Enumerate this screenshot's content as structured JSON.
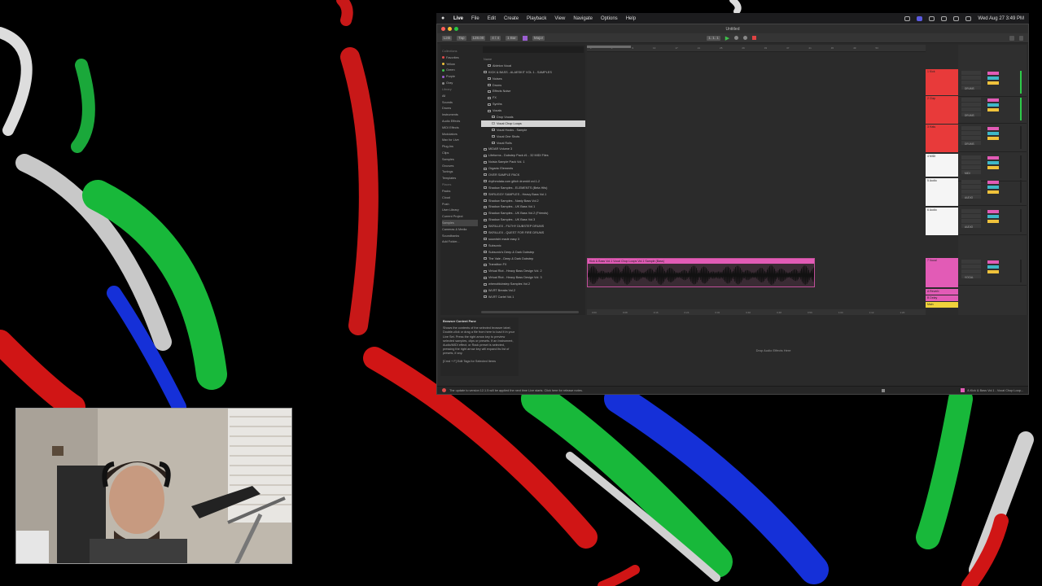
{
  "menubar": {
    "app": "Live",
    "items": [
      "File",
      "Edit",
      "Create",
      "Playback",
      "View",
      "Navigate",
      "Options",
      "Help"
    ],
    "clock": "Wed Aug 27 3:49 PM"
  },
  "window": {
    "title": "Untitled"
  },
  "transport": {
    "link": "Link",
    "tap": "Tap",
    "tempo": "128.00",
    "signature": "4 / 4",
    "quant": "1 Bar",
    "key": "Major",
    "position": "1. 1. 1"
  },
  "browser": {
    "collections_header": "Collections",
    "collections": [
      {
        "label": "Favorites",
        "color": "#e14b4b"
      },
      {
        "label": "Yellow",
        "color": "#f0c23b"
      },
      {
        "label": "Green",
        "color": "#3ec14b"
      },
      {
        "label": "Purple",
        "color": "#9a5fd0"
      },
      {
        "label": "Gray",
        "color": "#8a8a8a"
      }
    ],
    "library_header": "Library",
    "library": [
      "All",
      "Sounds",
      "Drums",
      "Instruments",
      "Audio Effects",
      "MIDI Effects",
      "Modulators",
      "Max for Live",
      "Plug-Ins",
      "Clips",
      "Samples",
      "Grooves",
      "Tunings",
      "Templates"
    ],
    "places_header": "Places",
    "places": [
      "Packs",
      "Cloud",
      "Push",
      "User Library",
      "Current Project",
      "Samples",
      "Cameras & Media",
      "Soundbanks",
      "Add Folder..."
    ],
    "search_placeholder": "Search",
    "name_header": "Name",
    "files": [
      "Ableton Vocal",
      "KICK & BASS - ALAESKIT VOL 1 - SAMPLES",
      "Noises",
      "Drums",
      "Effects Noise",
      "FX",
      "Synths",
      "Vocals",
      "Drop Vocals",
      "Vocal Chop Loops",
      "Vocal Hooks - Sample",
      "Vocal One Shots",
      "Vocal Rolls",
      "MIDAR Volume 3",
      "Lifeforms - Dubstep Pack #1 - 32 MIDI Files",
      "Noisia Sample Pack Vol. 1",
      "Organic Elements",
      "OVER SAMPLE PACK",
      "rhythmdata.com glitch drumkit vol.1-2",
      "Shadow Samples - ELEMENTS (Beta Hits)",
      "SHRUGGY SAMPLES - Heavy Bass Vol.1",
      "Shadow Samples - Nasty Bass Vol.2",
      "Shadow Samples - UK Bass Vol.1",
      "Shadow Samples - UK Bass Vol.2 (Friends)",
      "Shadow Samples - UK Bass Vol.3",
      "SKRILLEX - FILTHY DUBSTEP DRUMS",
      "SKRILLEX - QUEST FOR FIRE DRUMS",
      "soundshi made easy 3",
      "Subsonic",
      "Subsonic's Deep & Dark Dubstep",
      "The Vale - Deep & Dark Dubstep",
      "Transition FX",
      "Virtual Riot - Heavy Bass Design Vol. 2",
      "Virtual Riot - Heavy Bass Design Vol. 3",
      "whenofdubstep Samples Vol.2",
      "WLRT Breaks Vol.2",
      "WLRT Cartel Vol.1"
    ],
    "selected_index": 9
  },
  "arrangement": {
    "ruler": [
      "1",
      "5",
      "9",
      "13",
      "17",
      "21",
      "25",
      "29",
      "33",
      "37",
      "41",
      "45",
      "49",
      "53"
    ],
    "clip_name": "Kick & Bass Vol.1 Vocal Chop Loops Vol.1 Sample (Bass)",
    "time": [
      "0:00",
      "0:08",
      "0:16",
      "0:24",
      "0:32",
      "0:40",
      "0:48",
      "0:56",
      "1:04",
      "1:12",
      "1:20",
      "1:28"
    ]
  },
  "tracks": [
    {
      "name": "1 Kick",
      "color": "#e83a3a",
      "role": "DRUMS"
    },
    {
      "name": "2 Clap",
      "color": "#e83a3a",
      "role": "DRUMS"
    },
    {
      "name": "3 Hats",
      "color": "#e83a3a",
      "role": "DRUMS"
    },
    {
      "name": "4 MIDI",
      "color": "#f5f5f5",
      "role": "MIDI"
    },
    {
      "name": "5 Audio",
      "color": "#f5f5f5",
      "role": "AUDIO"
    },
    {
      "name": "6 Audio",
      "color": "#f5f5f5",
      "role": "AUDIO"
    },
    {
      "name": "7 Vocal",
      "color": "#e25bb6",
      "role": "VOCAL"
    }
  ],
  "returns": [
    {
      "name": "A Reverb",
      "color": "#e25bb6"
    },
    {
      "name": "B Delay",
      "color": "#e25bb6"
    },
    {
      "name": "Main",
      "color": "#f0d23b"
    }
  ],
  "info": {
    "title": "Browser Content Pane",
    "body": "Shows the contents of the selected browser label. Double-click or drag a file from here to load it in your Live Set. Press the right arrow key to preview selected samples, clips or presets. If an Instrument, Audio/MIDI effect, or Rack preset is selected, pressing the right arrow key will expand its list of presets, if any.",
    "hint": "[Cmd + F] Edit Tags for Selected Items"
  },
  "device": {
    "drop_text": "Drop Audio Effects Here"
  },
  "status": {
    "message": "The update to version 12.1.5 will be applied the next time Live starts. Click here for release notes.",
    "track": "8-Kick & Bass Vol.1 - Vocal Chop Loop..."
  }
}
